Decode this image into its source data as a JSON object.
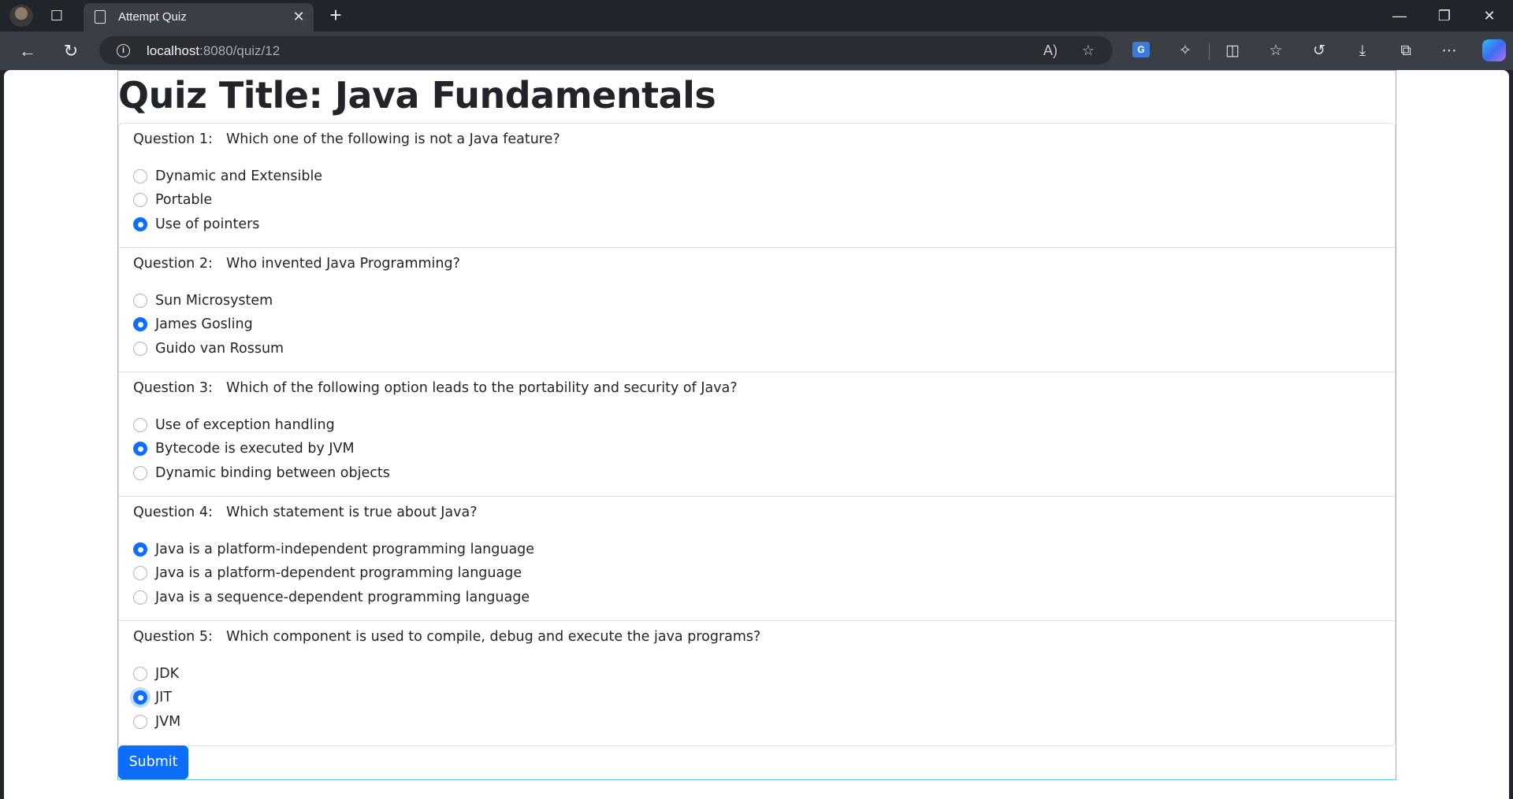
{
  "browser": {
    "tab_title": "Attempt Quiz",
    "url_host": "localhost",
    "url_path": ":8080/quiz/12",
    "translate_badge": "G"
  },
  "page": {
    "title": "Quiz Title: Java Fundamentals",
    "submit_label": "Submit",
    "accent_color": "#0d6efd",
    "questions": [
      {
        "number": "Question 1:",
        "text": "Which one of the following is not a Java feature?",
        "options": [
          "Dynamic and Extensible",
          "Portable",
          "Use of pointers"
        ],
        "selected": 2
      },
      {
        "number": "Question 2:",
        "text": "Who invented Java Programming?",
        "options": [
          "Sun Microsystem",
          "James Gosling",
          "Guido van Rossum"
        ],
        "selected": 1
      },
      {
        "number": "Question 3:",
        "text": "Which of the following option leads to the portability and security of Java?",
        "options": [
          "Use of exception handling",
          "Bytecode is executed by JVM",
          "Dynamic binding between objects"
        ],
        "selected": 1
      },
      {
        "number": "Question 4:",
        "text": "Which statement is true about Java?",
        "options": [
          "Java is a platform-independent programming language",
          "Java is a platform-dependent programming language",
          "Java is a sequence-dependent programming language"
        ],
        "selected": 0
      },
      {
        "number": "Question 5:",
        "text": "Which component is used to compile, debug and execute the java programs?",
        "options": [
          "JDK",
          "JIT",
          "JVM"
        ],
        "selected": 1
      }
    ]
  }
}
